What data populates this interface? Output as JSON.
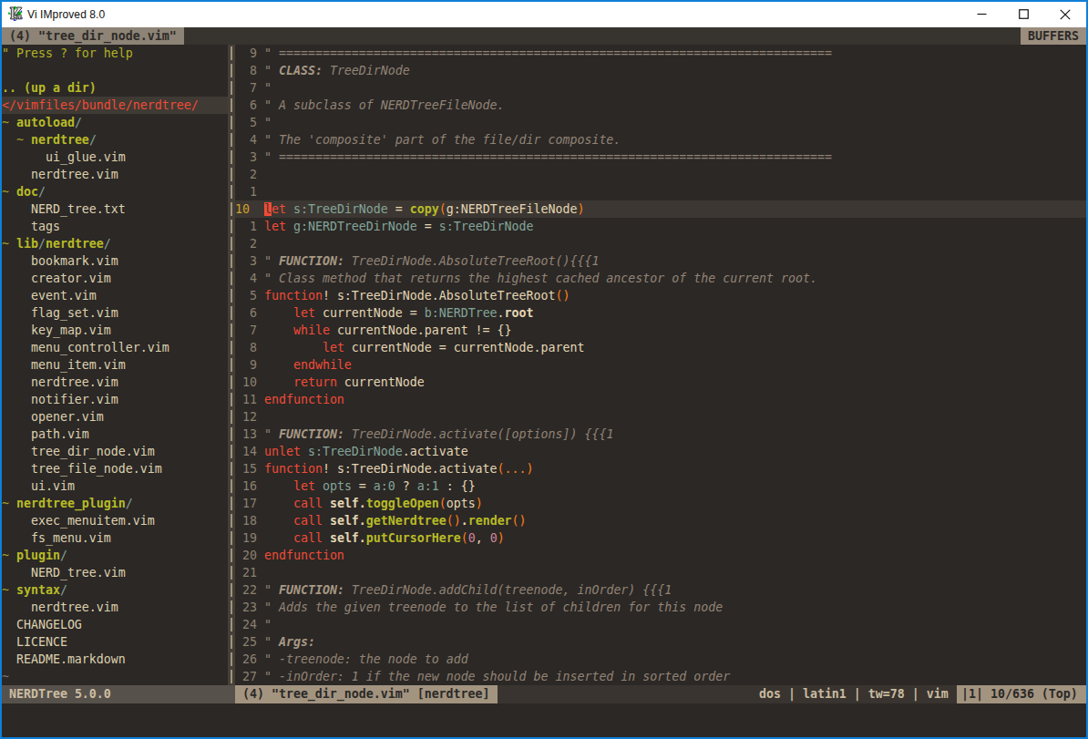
{
  "colors": {
    "border_blue": "#0f7fd7",
    "titlebar_bg": "#ffffff",
    "titlebar_fg": "#101010",
    "bg": "#2b2826",
    "cursorline": "#3c3732",
    "treeline": "#3f3a34",
    "vsep_bg": "#453f38",
    "vsep_dash": "#a2937d",
    "tabline_bg": "#37332e",
    "tab_bg": "#8d8376",
    "tab_fg": "#2d2b28",
    "buffers_bg": "#9b8e7f",
    "buffers_fg": "#2c2a27",
    "num": "#8b8170",
    "num_cur": "#d2a02a",
    "red": "#f24b36",
    "green": "#b8bb26",
    "blue": "#83a598",
    "orange": "#fe8019",
    "purple": "#d3869b",
    "fg": "#e4d6b2",
    "comment": "#928374",
    "comment_title": "#a89984",
    "cursor_bg": "#f24b36",
    "cursor_fg": "#3c3732",
    "help": "#b0b226",
    "tree_tilde": "#a59a27",
    "tree_file": "#ddd0ae",
    "nontext": "#7c6f64",
    "slnc_bg": "#57514b",
    "slnc_fg": "#cbbda2",
    "sl_bg": "#39342f",
    "sl_seg_bg": "#a39480",
    "sl_seg_fg": "#2a2927",
    "sl_flags_fg": "#c9bba0"
  },
  "window": {
    "title": "Vi IMproved 8.0",
    "icon": "vim-logo",
    "controls": {
      "minimize": "minimize",
      "maximize": "maximize",
      "close": "close"
    }
  },
  "tabline": {
    "active_tab": " (4) \"tree_dir_node.vim\" ",
    "right_label": " BUFFERS "
  },
  "tree": {
    "rows": [
      {
        "segs": [
          [
            "help",
            "\" Press ? for help"
          ]
        ]
      },
      {
        "segs": []
      },
      {
        "segs": [
          [
            "updir",
            ".. (up a dir)"
          ]
        ]
      },
      {
        "sel": true,
        "segs": [
          [
            "root",
            "</vimfiles/bundle/nerdtree/"
          ]
        ]
      },
      {
        "segs": [
          [
            "tilde",
            "~ "
          ],
          [
            "dir",
            "autoload"
          ],
          [
            "slash",
            "/"
          ]
        ]
      },
      {
        "segs": [
          [
            "file",
            "  "
          ],
          [
            "tilde",
            "~ "
          ],
          [
            "dir",
            "nerdtree"
          ],
          [
            "slash",
            "/"
          ]
        ]
      },
      {
        "segs": [
          [
            "file",
            "      ui_glue.vim"
          ]
        ]
      },
      {
        "segs": [
          [
            "file",
            "    nerdtree.vim"
          ]
        ]
      },
      {
        "segs": [
          [
            "tilde",
            "~ "
          ],
          [
            "dir",
            "doc"
          ],
          [
            "slash",
            "/"
          ]
        ]
      },
      {
        "segs": [
          [
            "file",
            "    NERD_tree.txt"
          ]
        ]
      },
      {
        "segs": [
          [
            "file",
            "    tags"
          ]
        ]
      },
      {
        "segs": [
          [
            "tilde",
            "~ "
          ],
          [
            "dir",
            "lib"
          ],
          [
            "slash",
            "/"
          ],
          [
            "dir",
            "nerdtree"
          ],
          [
            "slash",
            "/"
          ]
        ]
      },
      {
        "segs": [
          [
            "file",
            "    bookmark.vim"
          ]
        ]
      },
      {
        "segs": [
          [
            "file",
            "    creator.vim"
          ]
        ]
      },
      {
        "segs": [
          [
            "file",
            "    event.vim"
          ]
        ]
      },
      {
        "segs": [
          [
            "file",
            "    flag_set.vim"
          ]
        ]
      },
      {
        "segs": [
          [
            "file",
            "    key_map.vim"
          ]
        ]
      },
      {
        "segs": [
          [
            "file",
            "    menu_controller.vim"
          ]
        ]
      },
      {
        "segs": [
          [
            "file",
            "    menu_item.vim"
          ]
        ]
      },
      {
        "segs": [
          [
            "file",
            "    nerdtree.vim"
          ]
        ]
      },
      {
        "segs": [
          [
            "file",
            "    notifier.vim"
          ]
        ]
      },
      {
        "segs": [
          [
            "file",
            "    opener.vim"
          ]
        ]
      },
      {
        "segs": [
          [
            "file",
            "    path.vim"
          ]
        ]
      },
      {
        "segs": [
          [
            "file",
            "    tree_dir_node.vim"
          ]
        ]
      },
      {
        "segs": [
          [
            "file",
            "    tree_file_node.vim"
          ]
        ]
      },
      {
        "segs": [
          [
            "file",
            "    ui.vim"
          ]
        ]
      },
      {
        "segs": [
          [
            "tilde",
            "~ "
          ],
          [
            "dir",
            "nerdtree_plugin"
          ],
          [
            "slash",
            "/"
          ]
        ]
      },
      {
        "segs": [
          [
            "file",
            "    exec_menuitem.vim"
          ]
        ]
      },
      {
        "segs": [
          [
            "file",
            "    fs_menu.vim"
          ]
        ]
      },
      {
        "segs": [
          [
            "tilde",
            "~ "
          ],
          [
            "dir",
            "plugin"
          ],
          [
            "slash",
            "/"
          ]
        ]
      },
      {
        "segs": [
          [
            "file",
            "    NERD_tree.vim"
          ]
        ]
      },
      {
        "segs": [
          [
            "tilde",
            "~ "
          ],
          [
            "dir",
            "syntax"
          ],
          [
            "slash",
            "/"
          ]
        ]
      },
      {
        "segs": [
          [
            "file",
            "    nerdtree.vim"
          ]
        ]
      },
      {
        "segs": [
          [
            "file",
            "  CHANGELOG"
          ]
        ]
      },
      {
        "segs": [
          [
            "file",
            "  LICENCE"
          ]
        ]
      },
      {
        "segs": [
          [
            "file",
            "  README.markdown"
          ]
        ]
      },
      {
        "segs": [
          [
            "nontext",
            "~"
          ]
        ]
      }
    ]
  },
  "editor": {
    "rows": [
      {
        "num": "  9 ",
        "segs": [
          [
            "cm",
            "\" ============================================================================"
          ]
        ]
      },
      {
        "num": "  8 ",
        "segs": [
          [
            "cm",
            "\" "
          ],
          [
            "cmt",
            "CLASS:"
          ],
          [
            "cm",
            " TreeDirNode"
          ]
        ]
      },
      {
        "num": "  7 ",
        "segs": [
          [
            "cm",
            "\""
          ]
        ]
      },
      {
        "num": "  6 ",
        "segs": [
          [
            "cm",
            "\" A subclass of NERDTreeFileNode."
          ]
        ]
      },
      {
        "num": "  5 ",
        "segs": [
          [
            "cm",
            "\""
          ]
        ]
      },
      {
        "num": "  4 ",
        "segs": [
          [
            "cm",
            "\" The 'composite' part of the file/dir composite."
          ]
        ]
      },
      {
        "num": "  3 ",
        "segs": [
          [
            "cm",
            "\" ============================================================================"
          ]
        ]
      },
      {
        "num": "  2 ",
        "segs": []
      },
      {
        "num": "  1 ",
        "segs": []
      },
      {
        "num": "10  ",
        "cur": true,
        "segs": [
          [
            "cursor",
            "l"
          ],
          [
            "kw",
            "et"
          ],
          [
            "fg",
            " "
          ],
          [
            "var",
            "s:TreeDirNode"
          ],
          [
            "fg",
            " = "
          ],
          [
            "fn",
            "copy"
          ],
          [
            "paren",
            "("
          ],
          [
            "fg",
            "g:NERDTreeFileNode"
          ],
          [
            "paren",
            ")"
          ]
        ]
      },
      {
        "num": "  1 ",
        "segs": [
          [
            "kw",
            "let"
          ],
          [
            "fg",
            " "
          ],
          [
            "var",
            "g:NERDTreeDirNode"
          ],
          [
            "fg",
            " = "
          ],
          [
            "var",
            "s:TreeDirNode"
          ]
        ]
      },
      {
        "num": "  2 ",
        "segs": []
      },
      {
        "num": "  3 ",
        "segs": [
          [
            "cm",
            "\" "
          ],
          [
            "cmt",
            "FUNCTION:"
          ],
          [
            "cm",
            " TreeDirNode.AbsoluteTreeRoot(){{{1"
          ]
        ]
      },
      {
        "num": "  4 ",
        "segs": [
          [
            "cm",
            "\" Class method that returns the highest cached ancestor of the current root."
          ]
        ]
      },
      {
        "num": "  5 ",
        "segs": [
          [
            "kw",
            "function"
          ],
          [
            "fg",
            "! s:TreeDirNode.AbsoluteTreeRoot"
          ],
          [
            "paren",
            "()"
          ]
        ]
      },
      {
        "num": "  6 ",
        "segs": [
          [
            "fg",
            "    "
          ],
          [
            "kw",
            "let"
          ],
          [
            "fg",
            " currentNode = "
          ],
          [
            "var",
            "b:NERDTree"
          ],
          [
            "fg",
            "."
          ],
          [
            "fgb",
            "root"
          ]
        ]
      },
      {
        "num": "  7 ",
        "segs": [
          [
            "fg",
            "    "
          ],
          [
            "kw",
            "while"
          ],
          [
            "fg",
            " currentNode.parent != {}"
          ]
        ]
      },
      {
        "num": "  8 ",
        "segs": [
          [
            "fg",
            "        "
          ],
          [
            "kw",
            "let"
          ],
          [
            "fg",
            " currentNode = currentNode.parent"
          ]
        ]
      },
      {
        "num": "  9 ",
        "segs": [
          [
            "fg",
            "    "
          ],
          [
            "kw",
            "endwhile"
          ]
        ]
      },
      {
        "num": " 10 ",
        "segs": [
          [
            "fg",
            "    "
          ],
          [
            "kw",
            "return"
          ],
          [
            "fg",
            " currentNode"
          ]
        ]
      },
      {
        "num": " 11 ",
        "segs": [
          [
            "kw",
            "endfunction"
          ]
        ]
      },
      {
        "num": " 12 ",
        "segs": []
      },
      {
        "num": " 13 ",
        "segs": [
          [
            "cm",
            "\" "
          ],
          [
            "cmt",
            "FUNCTION:"
          ],
          [
            "cm",
            " TreeDirNode.activate([options]) {{{1"
          ]
        ]
      },
      {
        "num": " 14 ",
        "segs": [
          [
            "kw",
            "unlet"
          ],
          [
            "fg",
            " "
          ],
          [
            "var",
            "s:TreeDirNode"
          ],
          [
            "fg",
            ".activate"
          ]
        ]
      },
      {
        "num": " 15 ",
        "segs": [
          [
            "kw",
            "function"
          ],
          [
            "fg",
            "! s:TreeDirNode.activate"
          ],
          [
            "paren",
            "(...)"
          ]
        ]
      },
      {
        "num": " 16 ",
        "segs": [
          [
            "fg",
            "    "
          ],
          [
            "kw",
            "let"
          ],
          [
            "fg",
            " "
          ],
          [
            "var",
            "opts"
          ],
          [
            "fg",
            " = "
          ],
          [
            "var",
            "a:0"
          ],
          [
            "fg",
            " ? "
          ],
          [
            "var",
            "a:1"
          ],
          [
            "fg",
            " : {}"
          ]
        ]
      },
      {
        "num": " 17 ",
        "segs": [
          [
            "fg",
            "    "
          ],
          [
            "kw",
            "call"
          ],
          [
            "fg",
            " "
          ],
          [
            "fgb",
            "self."
          ],
          [
            "fn",
            "toggleOpen"
          ],
          [
            "paren",
            "("
          ],
          [
            "fg",
            "opts"
          ],
          [
            "paren",
            ")"
          ]
        ]
      },
      {
        "num": " 18 ",
        "segs": [
          [
            "fg",
            "    "
          ],
          [
            "kw",
            "call"
          ],
          [
            "fg",
            " "
          ],
          [
            "fgb",
            "self."
          ],
          [
            "fn",
            "getNerdtree"
          ],
          [
            "paren",
            "()"
          ],
          [
            "fgb",
            "."
          ],
          [
            "fn",
            "render"
          ],
          [
            "paren",
            "()"
          ]
        ]
      },
      {
        "num": " 19 ",
        "segs": [
          [
            "fg",
            "    "
          ],
          [
            "kw",
            "call"
          ],
          [
            "fg",
            " "
          ],
          [
            "fgb",
            "self."
          ],
          [
            "fn",
            "putCursorHere"
          ],
          [
            "paren",
            "("
          ],
          [
            "num",
            "0"
          ],
          [
            "fg",
            ", "
          ],
          [
            "num",
            "0"
          ],
          [
            "paren",
            ")"
          ]
        ]
      },
      {
        "num": " 20 ",
        "segs": [
          [
            "kw",
            "endfunction"
          ]
        ]
      },
      {
        "num": " 21 ",
        "segs": []
      },
      {
        "num": " 22 ",
        "segs": [
          [
            "cm",
            "\" "
          ],
          [
            "cmt",
            "FUNCTION:"
          ],
          [
            "cm",
            " TreeDirNode.addChild(treenode, inOrder) {{{1"
          ]
        ]
      },
      {
        "num": " 23 ",
        "segs": [
          [
            "cm",
            "\" Adds the given treenode to the list of children for this node"
          ]
        ]
      },
      {
        "num": " 24 ",
        "segs": [
          [
            "cm",
            "\""
          ]
        ]
      },
      {
        "num": " 25 ",
        "segs": [
          [
            "cm",
            "\" "
          ],
          [
            "cmt",
            "Args:"
          ]
        ]
      },
      {
        "num": " 26 ",
        "segs": [
          [
            "cm",
            "\" -treenode: the node to add"
          ]
        ]
      },
      {
        "num": " 27 ",
        "segs": [
          [
            "cm",
            "\" -inOrder: 1 if the new node should be inserted in sorted order"
          ]
        ]
      }
    ]
  },
  "statusline": {
    "left": "NERDTree 5.0.0",
    "file": " (4) \"tree_dir_node.vim\" [nerdtree] ",
    "flags": "dos | latin1 | tw=78 | vim",
    "position": "|1| 10/636 (Top)"
  }
}
